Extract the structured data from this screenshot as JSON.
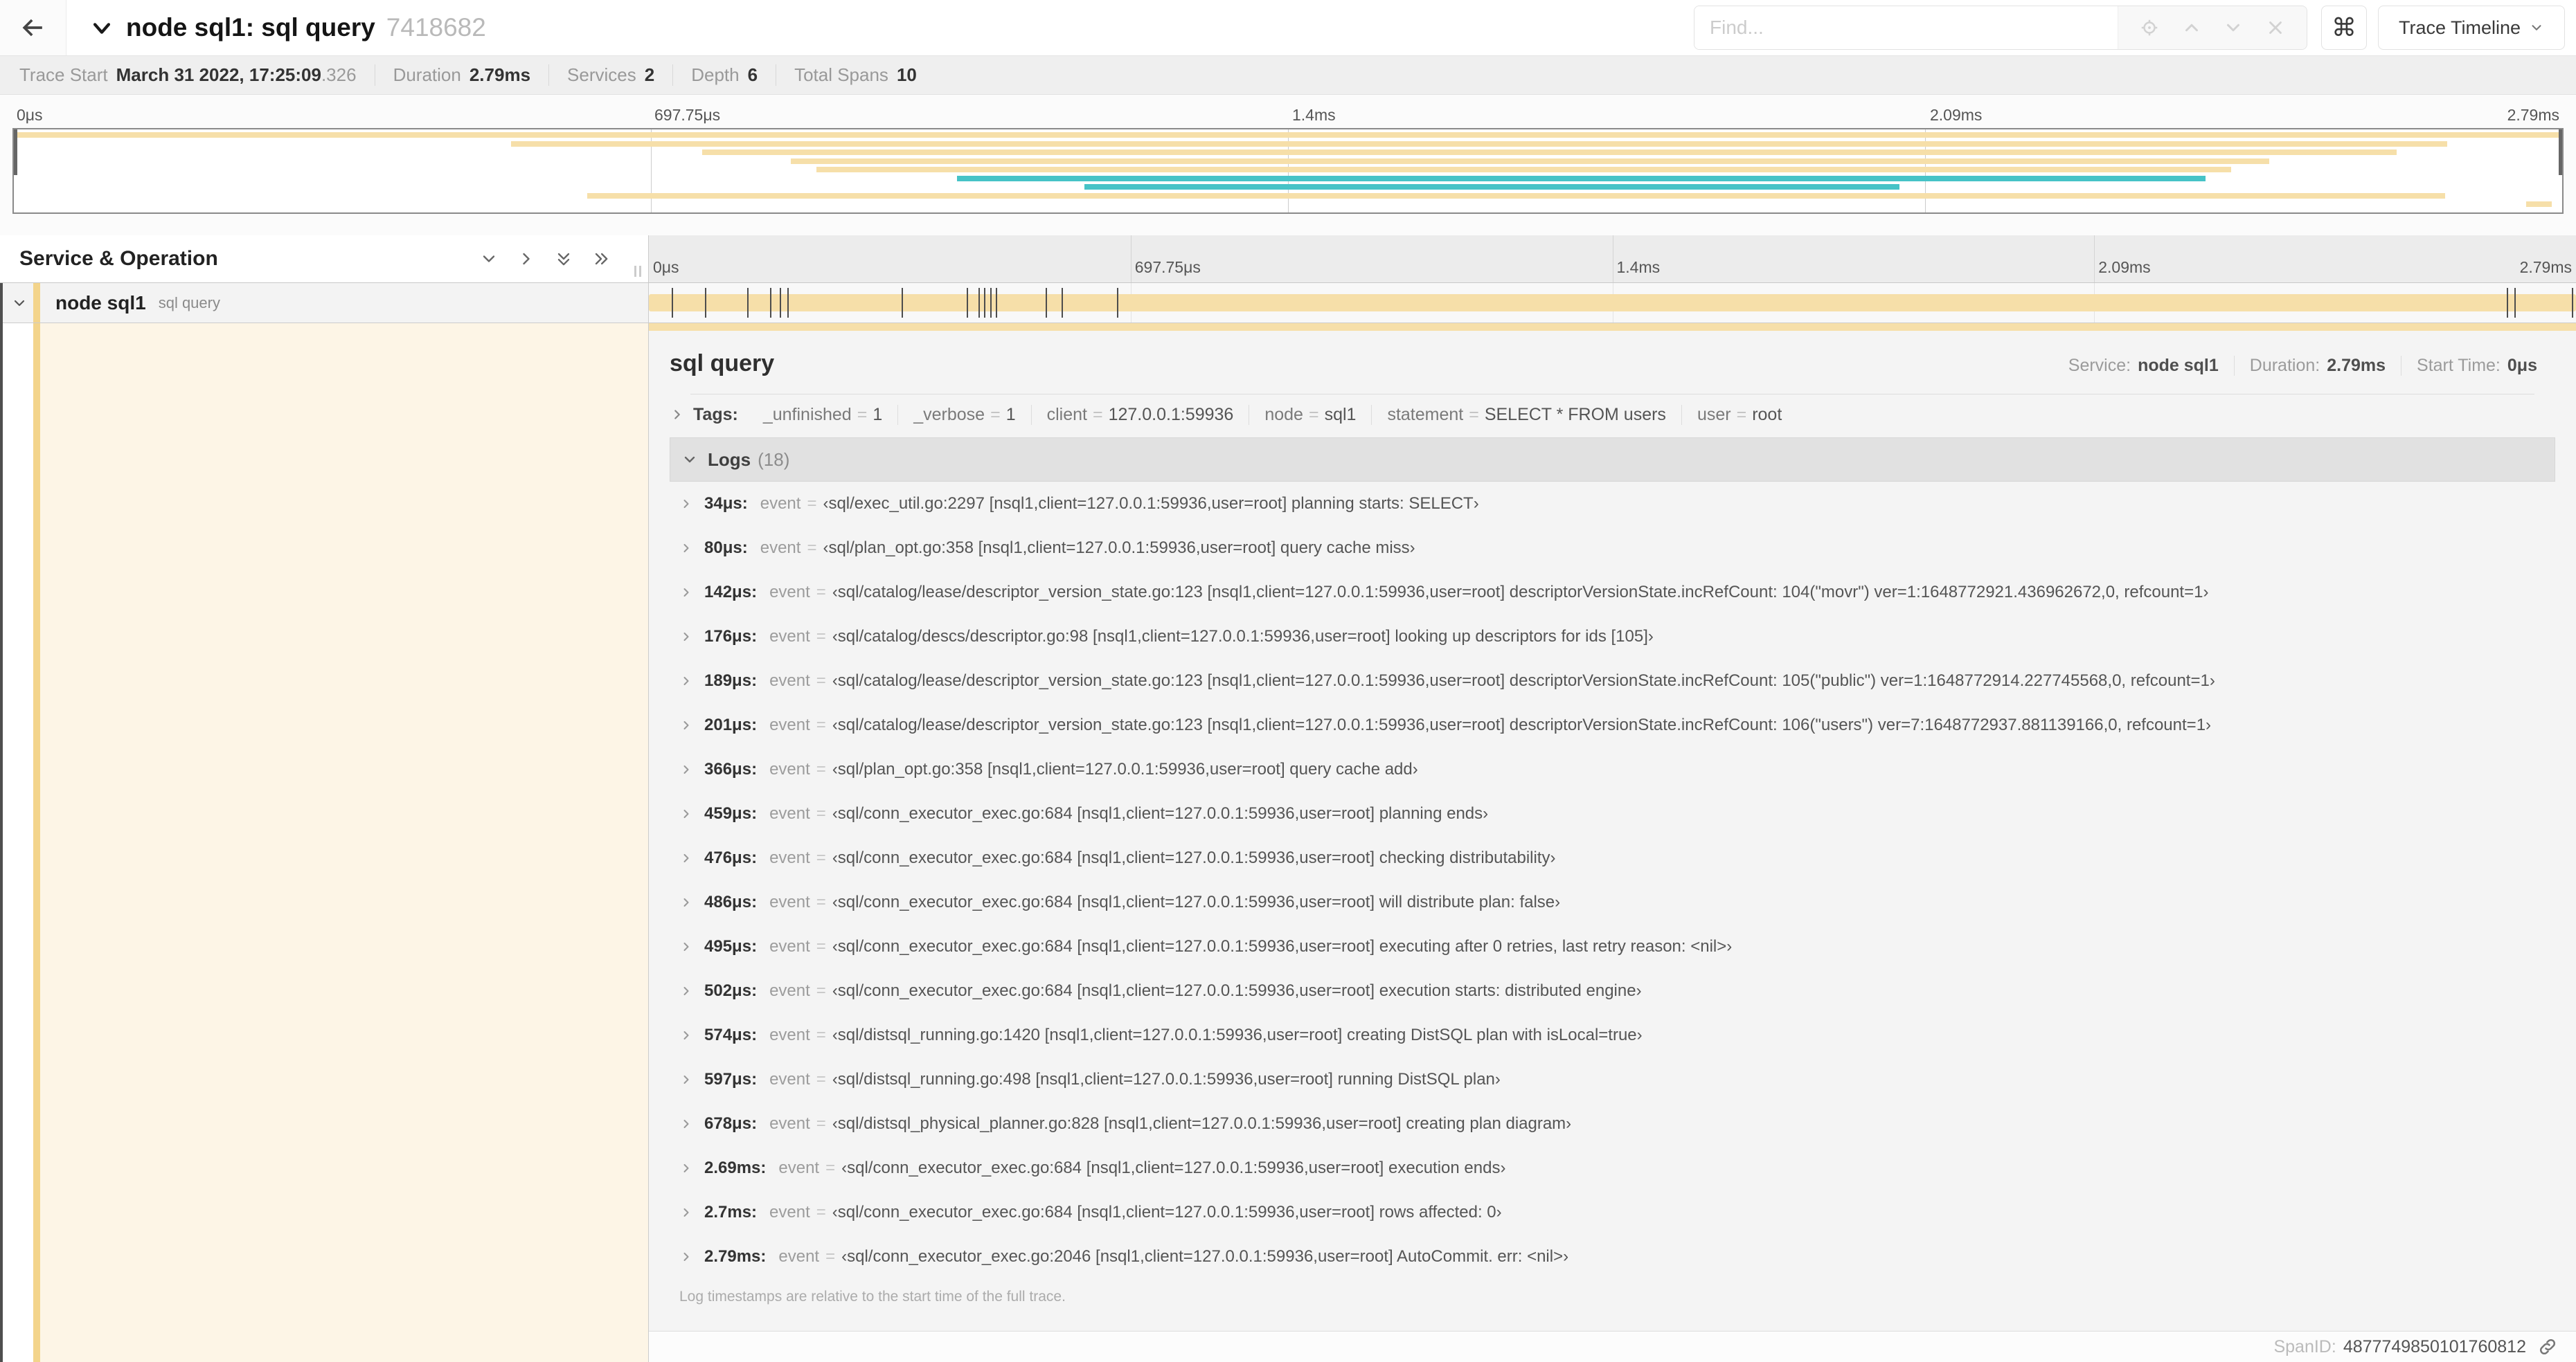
{
  "header": {
    "title": "node sql1: sql query",
    "trace_id": "7418682",
    "find_placeholder": "Find...",
    "shortcut_key": "⌘",
    "view_selector": "Trace Timeline"
  },
  "summary": {
    "items": [
      {
        "label": "Trace Start",
        "value": "March 31 2022, 17:25:09",
        "suffix": ".326"
      },
      {
        "label": "Duration",
        "value": "2.79ms"
      },
      {
        "label": "Services",
        "value": "2"
      },
      {
        "label": "Depth",
        "value": "6"
      },
      {
        "label": "Total Spans",
        "value": "10"
      }
    ]
  },
  "timeline": {
    "ticks": [
      {
        "label": "0μs",
        "pos": 0
      },
      {
        "label": "697.75μs",
        "pos": 25
      },
      {
        "label": "1.4ms",
        "pos": 50
      },
      {
        "label": "2.09ms",
        "pos": 75
      },
      {
        "label": "2.79ms",
        "pos": 100,
        "align": "right"
      }
    ],
    "minimap_bars": [
      {
        "row": 0,
        "start": 0,
        "end": 100,
        "color": "#f6dfa9"
      },
      {
        "row": 1,
        "start": 19.5,
        "end": 95.5,
        "color": "#f6dfa9"
      },
      {
        "row": 2,
        "start": 27,
        "end": 93.5,
        "color": "#f6dfa9"
      },
      {
        "row": 3,
        "start": 30.5,
        "end": 88.5,
        "color": "#f6dfa9"
      },
      {
        "row": 4,
        "start": 31.5,
        "end": 87,
        "color": "#f6dfa9"
      },
      {
        "row": 5,
        "start": 37,
        "end": 86,
        "color": "#46c3c7"
      },
      {
        "row": 6,
        "start": 42,
        "end": 74,
        "color": "#46c3c7"
      },
      {
        "row": 7,
        "start": 22.5,
        "end": 95.4,
        "color": "#f6dfa9"
      },
      {
        "row": 8,
        "start": 98.6,
        "end": 99.6,
        "color": "#f6dfa9"
      }
    ],
    "log_marks": [
      {
        "start": 1.2
      },
      {
        "start": 2.9
      },
      {
        "start": 5.1
      },
      {
        "start": 6.3
      },
      {
        "start": 6.8
      },
      {
        "start": 7.2
      },
      {
        "start": 13.1
      },
      {
        "start": 16.5
      },
      {
        "start": 17.1
      },
      {
        "start": 17.4
      },
      {
        "start": 17.7
      },
      {
        "start": 18.0
      },
      {
        "start": 20.6
      },
      {
        "start": 21.4
      },
      {
        "start": 24.3
      },
      {
        "start": 96.4
      },
      {
        "start": 96.8
      },
      {
        "start": 99.8
      }
    ]
  },
  "span_list": {
    "header": "Service & Operation",
    "row": {
      "service": "node sql1",
      "operation": "sql query"
    }
  },
  "detail": {
    "title": "sql query",
    "meta": [
      {
        "label": "Service:",
        "value": "node sql1"
      },
      {
        "label": "Duration:",
        "value": "2.79ms"
      },
      {
        "label": "Start Time:",
        "value": "0μs"
      }
    ],
    "tags_label": "Tags:",
    "tags": [
      {
        "key": "_unfinished",
        "value": "1"
      },
      {
        "key": "_verbose",
        "value": "1"
      },
      {
        "key": "client",
        "value": "127.0.0.1:59936"
      },
      {
        "key": "node",
        "value": "sql1"
      },
      {
        "key": "statement",
        "value": "SELECT * FROM users"
      },
      {
        "key": "user",
        "value": "root"
      }
    ],
    "logs_label": "Logs",
    "logs_count": "(18)",
    "logs": [
      {
        "time": "34μs:",
        "key": "event",
        "value": "‹sql/exec_util.go:2297 [nsql1,client=127.0.0.1:59936,user=root] planning starts: SELECT›"
      },
      {
        "time": "80μs:",
        "key": "event",
        "value": "‹sql/plan_opt.go:358 [nsql1,client=127.0.0.1:59936,user=root] query cache miss›"
      },
      {
        "time": "142μs:",
        "key": "event",
        "value": "‹sql/catalog/lease/descriptor_version_state.go:123 [nsql1,client=127.0.0.1:59936,user=root] descriptorVersionState.incRefCount: 104(\"movr\") ver=1:1648772921.436962672,0, refcount=1›"
      },
      {
        "time": "176μs:",
        "key": "event",
        "value": "‹sql/catalog/descs/descriptor.go:98 [nsql1,client=127.0.0.1:59936,user=root] looking up descriptors for ids [105]›"
      },
      {
        "time": "189μs:",
        "key": "event",
        "value": "‹sql/catalog/lease/descriptor_version_state.go:123 [nsql1,client=127.0.0.1:59936,user=root] descriptorVersionState.incRefCount: 105(\"public\") ver=1:1648772914.227745568,0, refcount=1›"
      },
      {
        "time": "201μs:",
        "key": "event",
        "value": "‹sql/catalog/lease/descriptor_version_state.go:123 [nsql1,client=127.0.0.1:59936,user=root] descriptorVersionState.incRefCount: 106(\"users\") ver=7:1648772937.881139166,0, refcount=1›"
      },
      {
        "time": "366μs:",
        "key": "event",
        "value": "‹sql/plan_opt.go:358 [nsql1,client=127.0.0.1:59936,user=root] query cache add›"
      },
      {
        "time": "459μs:",
        "key": "event",
        "value": "‹sql/conn_executor_exec.go:684 [nsql1,client=127.0.0.1:59936,user=root] planning ends›"
      },
      {
        "time": "476μs:",
        "key": "event",
        "value": "‹sql/conn_executor_exec.go:684 [nsql1,client=127.0.0.1:59936,user=root] checking distributability›"
      },
      {
        "time": "486μs:",
        "key": "event",
        "value": "‹sql/conn_executor_exec.go:684 [nsql1,client=127.0.0.1:59936,user=root] will distribute plan: false›"
      },
      {
        "time": "495μs:",
        "key": "event",
        "value": "‹sql/conn_executor_exec.go:684 [nsql1,client=127.0.0.1:59936,user=root] executing after 0 retries, last retry reason: <nil>›"
      },
      {
        "time": "502μs:",
        "key": "event",
        "value": "‹sql/conn_executor_exec.go:684 [nsql1,client=127.0.0.1:59936,user=root] execution starts: distributed engine›"
      },
      {
        "time": "574μs:",
        "key": "event",
        "value": "‹sql/distsql_running.go:1420 [nsql1,client=127.0.0.1:59936,user=root] creating DistSQL plan with isLocal=true›"
      },
      {
        "time": "597μs:",
        "key": "event",
        "value": "‹sql/distsql_running.go:498 [nsql1,client=127.0.0.1:59936,user=root] running DistSQL plan›"
      },
      {
        "time": "678μs:",
        "key": "event",
        "value": "‹sql/distsql_physical_planner.go:828 [nsql1,client=127.0.0.1:59936,user=root] creating plan diagram›"
      },
      {
        "time": "2.69ms:",
        "key": "event",
        "value": "‹sql/conn_executor_exec.go:684 [nsql1,client=127.0.0.1:59936,user=root] execution ends›"
      },
      {
        "time": "2.7ms:",
        "key": "event",
        "value": "‹sql/conn_executor_exec.go:684 [nsql1,client=127.0.0.1:59936,user=root] rows affected: 0›"
      },
      {
        "time": "2.79ms:",
        "key": "event",
        "value": "‹sql/conn_executor_exec.go:2046 [nsql1,client=127.0.0.1:59936,user=root] AutoCommit. err: <nil>›"
      }
    ],
    "logs_note": "Log timestamps are relative to the start time of the full trace.",
    "spanid_label": "SpanID:",
    "spanid_value": "4877749850101760812"
  },
  "colors": {
    "span_tan": "#f6dfa9",
    "accent_tan": "#f3d48b",
    "teal": "#46c3c7"
  }
}
